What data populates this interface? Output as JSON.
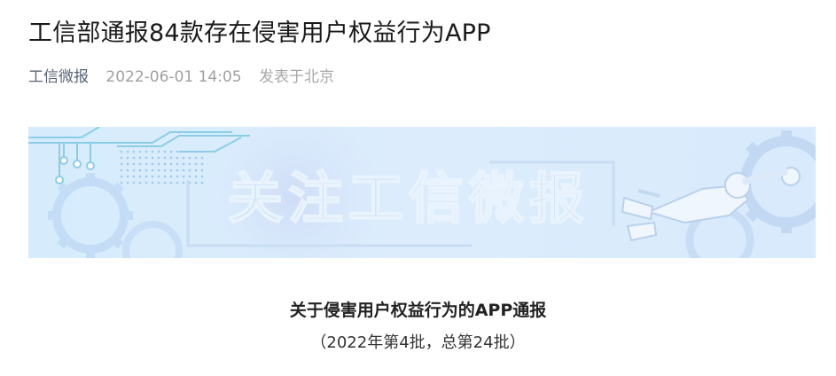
{
  "article": {
    "title": "工信部通报84款存在侵害用户权益行为APP",
    "author": "工信微报",
    "date": "2022-06-01 14:05",
    "location": "发表于北京"
  },
  "banner": {
    "text": "关注工信微报",
    "colors": {
      "background": "#dbeeff",
      "circuit": "#8fd0e8",
      "gear": "#c6defa"
    }
  },
  "notice": {
    "title": "关于侵害用户权益行为的APP通报",
    "subtitle": "（2022年第4批，总第24批）"
  }
}
